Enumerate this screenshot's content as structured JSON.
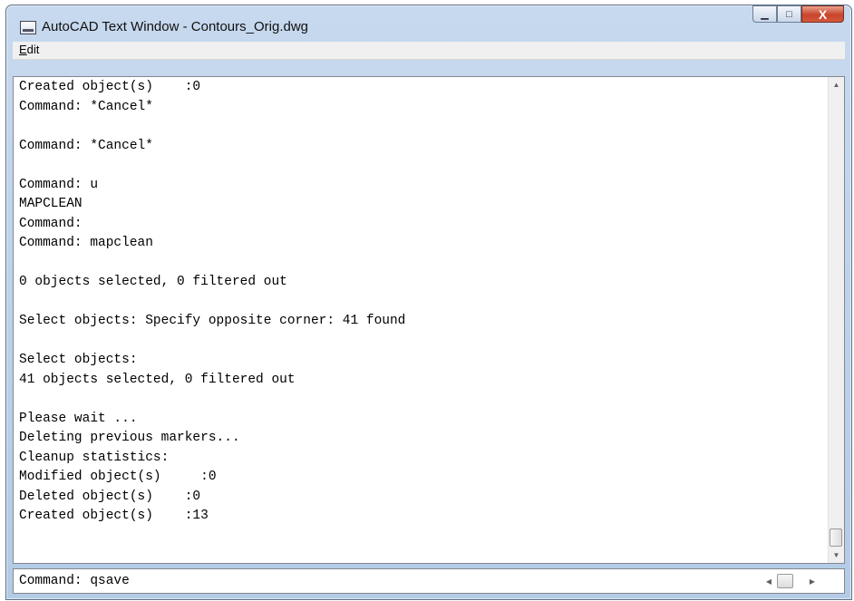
{
  "window": {
    "title": "AutoCAD Text Window - Contours_Orig.dwg"
  },
  "caption_buttons": {
    "minimize": "▁",
    "maximize": "□",
    "close": "X"
  },
  "menu": {
    "items": [
      "Edit"
    ]
  },
  "history": {
    "lines": [
      "Created object(s)    :0",
      "Command: *Cancel*",
      "",
      "Command: *Cancel*",
      "",
      "Command: u",
      "MAPCLEAN",
      "Command:",
      "Command: mapclean",
      "",
      "0 objects selected, 0 filtered out",
      "",
      "Select objects: Specify opposite corner: 41 found",
      "",
      "Select objects:",
      "41 objects selected, 0 filtered out",
      "",
      "Please wait ...",
      "Deleting previous markers...",
      "Cleanup statistics:",
      "Modified object(s)     :0",
      "Deleted object(s)    :0",
      "Created object(s)    :13"
    ]
  },
  "scrollbar": {
    "up": "▲",
    "down": "▼",
    "left": "◀",
    "right": "▶"
  },
  "command_line": {
    "value": "Command: qsave"
  },
  "icons": {
    "app": "text-window-icon",
    "minimize": "minimize-icon",
    "maximize": "maximize-icon",
    "close": "close-icon"
  }
}
